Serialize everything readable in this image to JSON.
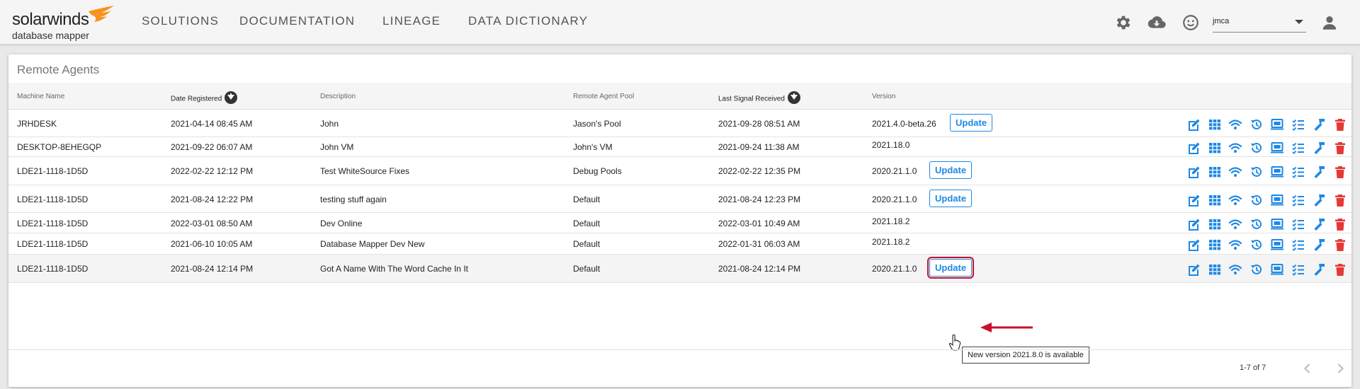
{
  "header": {
    "logo_main": "solarwinds",
    "logo_sub": "database mapper",
    "nav": [
      "SOLUTIONS",
      "DOCUMENTATION",
      "LINEAGE",
      "DATA DICTIONARY"
    ],
    "user": "jmca",
    "icons": [
      "gear-icon",
      "cloud-download-icon",
      "smiley-icon",
      "user-icon"
    ]
  },
  "panel": {
    "title": "Remote Agents",
    "columns": [
      "Machine Name",
      "Date Registered",
      "Description",
      "Remote Agent Pool",
      "Last Signal Received",
      "Version"
    ],
    "sorted_columns": [
      "Date Registered",
      "Last Signal Received"
    ],
    "rows": [
      {
        "machine": "JRHDESK",
        "registered": "2021-04-14 08:45 AM",
        "description": "John",
        "pool": "Jason's Pool",
        "last_signal": "2021-09-28 08:51 AM",
        "version": "2021.4.0-beta.26",
        "update": "Update"
      },
      {
        "machine": "DESKTOP-8EHEGQP",
        "registered": "2021-09-22 06:07 AM",
        "description": "John VM",
        "pool": "John's VM",
        "last_signal": "2021-09-24 11:38 AM",
        "version": "2021.18.0",
        "update": ""
      },
      {
        "machine": "LDE21-1118-1D5D",
        "registered": "2022-02-22 12:12 PM",
        "description": "Test WhiteSource Fixes",
        "pool": "Debug Pools",
        "last_signal": "2022-02-22 12:35 PM",
        "version": "2020.21.1.0",
        "update": "Update"
      },
      {
        "machine": "LDE21-1118-1D5D",
        "registered": "2021-08-24 12:22 PM",
        "description": "testing stuff again",
        "pool": "Default",
        "last_signal": "2021-08-24 12:23 PM",
        "version": "2020.21.1.0",
        "update": "Update"
      },
      {
        "machine": "LDE21-1118-1D5D",
        "registered": "2022-03-01 08:50 AM",
        "description": "Dev Online",
        "pool": "Default",
        "last_signal": "2022-03-01 10:49 AM",
        "version": "2021.18.2",
        "update": ""
      },
      {
        "machine": "LDE21-1118-1D5D",
        "registered": "2021-06-10 10:05 AM",
        "description": "Database Mapper Dev New",
        "pool": "Default",
        "last_signal": "2022-01-31 06:03 AM",
        "version": "2021.18.2",
        "update": ""
      },
      {
        "machine": "LDE21-1118-1D5D",
        "registered": "2021-08-24 12:14 PM",
        "description": "Got A Name With The Word Cache In It",
        "pool": "Default",
        "last_signal": "2021-08-24 12:14 PM",
        "version": "2020.21.1.0",
        "update": "Update"
      }
    ],
    "row_actions": [
      "edit-icon",
      "grid-icon",
      "wifi-icon",
      "history-icon",
      "monitor-icon",
      "checklist-icon",
      "hammer-icon",
      "trash-icon"
    ],
    "tooltip": "New version 2021.8.0 is available",
    "pager": "1-7 of 7"
  },
  "colors": {
    "accent": "#1e88e5",
    "danger": "#e53935",
    "callout": "#c8102e",
    "logo_orange": "#f7931e"
  }
}
